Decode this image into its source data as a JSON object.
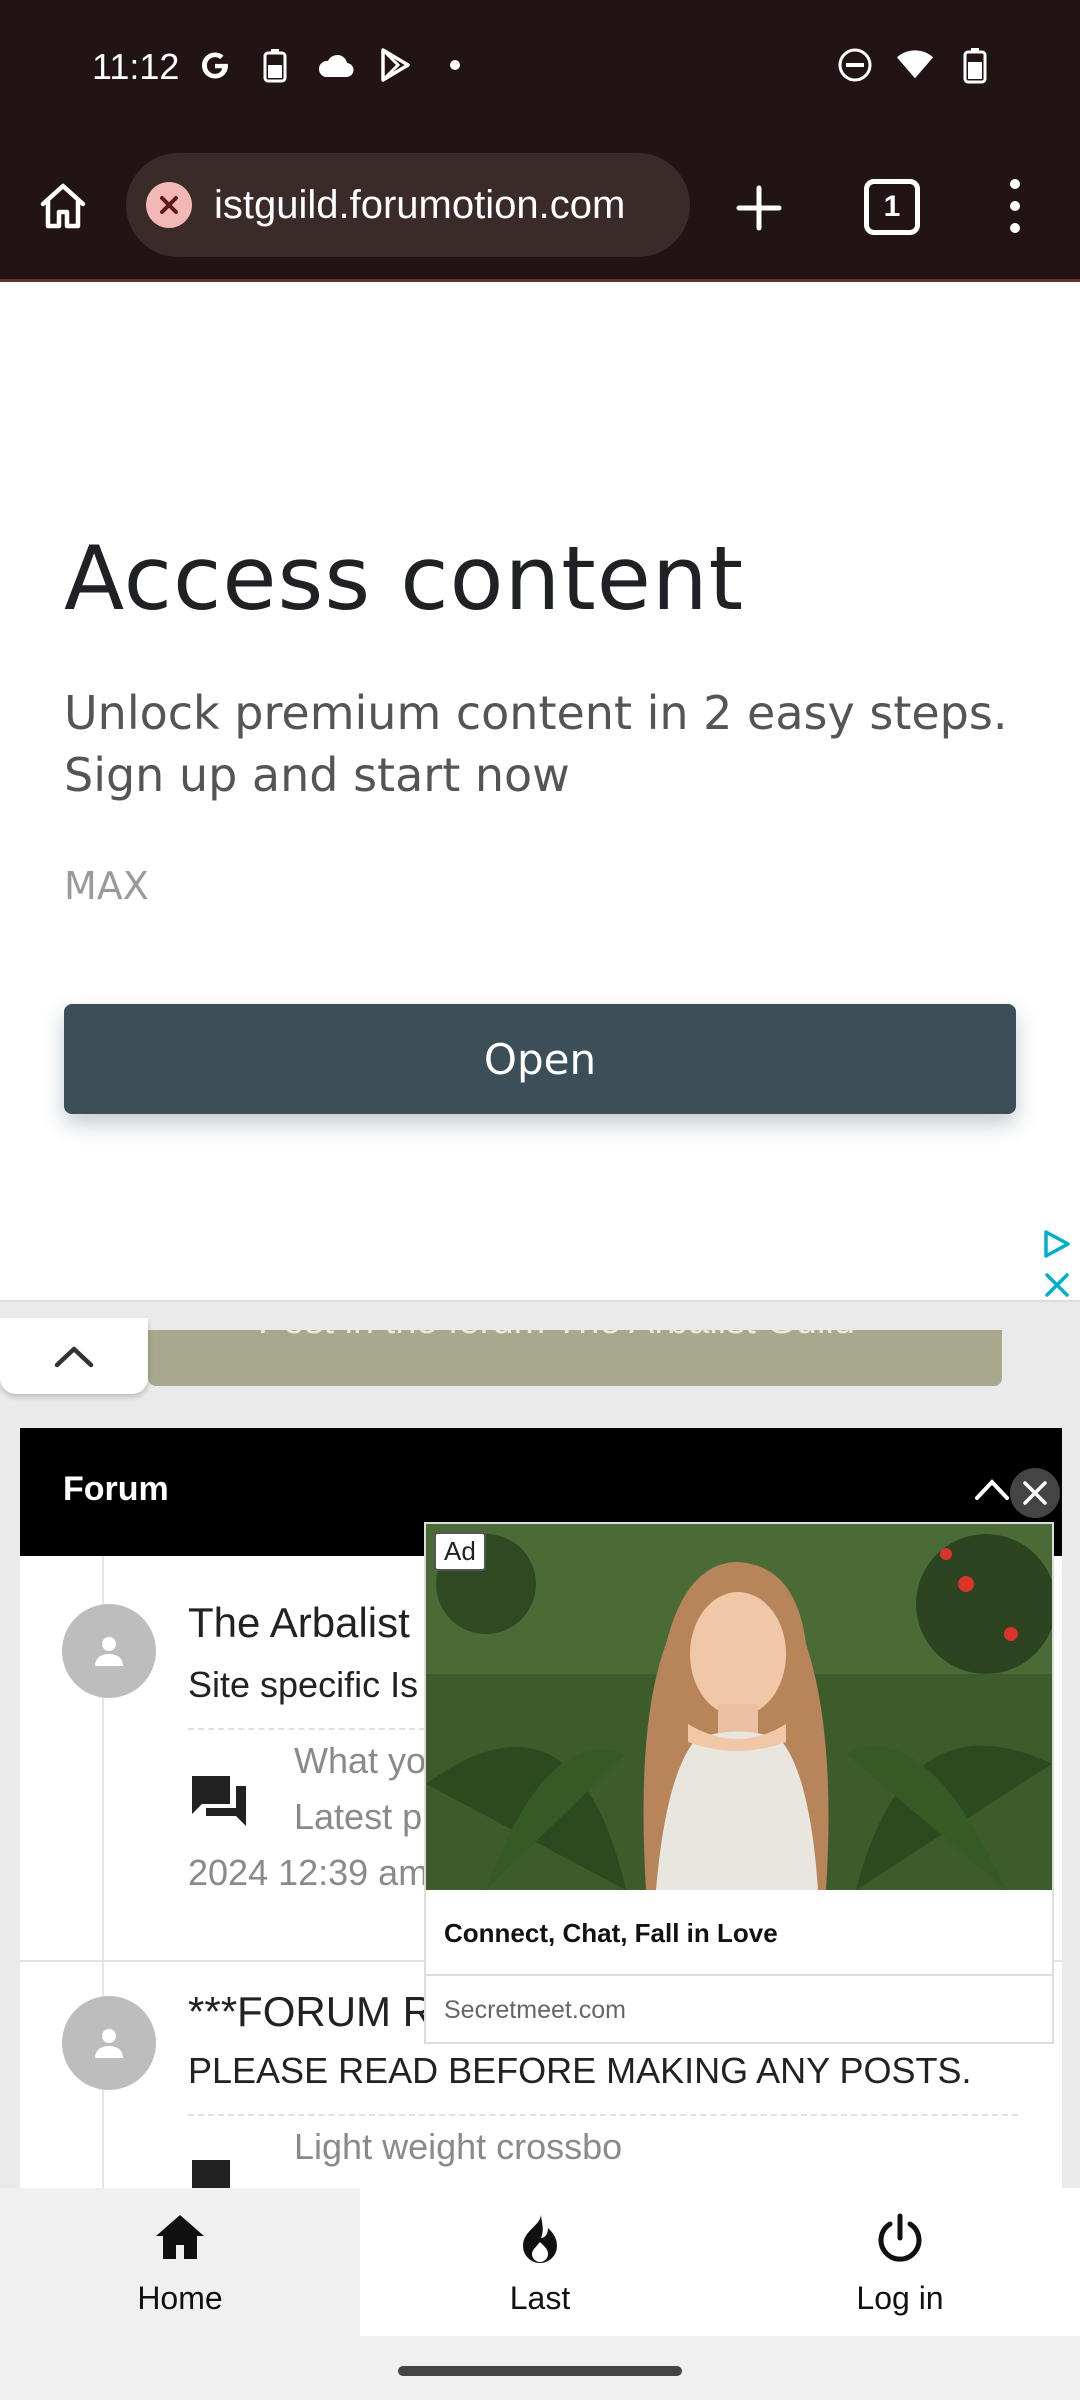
{
  "status_bar": {
    "time": "11:12",
    "left_icons": [
      "google-icon",
      "battery-saver-icon",
      "cloud-icon",
      "play-store-icon",
      "dot-icon"
    ],
    "right_icons": [
      "do-not-disturb-icon",
      "wifi-icon",
      "battery-icon"
    ]
  },
  "browser": {
    "url": "istguild.forumotion.com",
    "tab_count": "1"
  },
  "top_ad": {
    "title": "Access content",
    "description": "Unlock premium content in 2 easy steps. Sign up and start now",
    "brand": "MAX",
    "button_label": "Open"
  },
  "banner": {
    "text": "Post in the forum The Arbalist Guild"
  },
  "forum": {
    "header_title": "Forum",
    "rows": [
      {
        "title": "The Arbalist",
        "description": "Site specific Is",
        "last_post_line1": "What yo",
        "last_post_line2": "Latest p",
        "last_post_date": "2024 12:39 am"
      },
      {
        "title": "***FORUM RULES & FAQ",
        "description": "PLEASE READ BEFORE MAKING ANY POSTS.",
        "last_post_line1": "Light weight crossbo"
      }
    ]
  },
  "float_ad": {
    "badge": "Ad",
    "headline": "Connect, Chat, Fall in Love",
    "domain": "Secretmeet.com"
  },
  "bottom_nav": {
    "items": [
      {
        "label": "Home",
        "icon": "home-icon",
        "active": true
      },
      {
        "label": "Last",
        "icon": "flame-icon",
        "active": false
      },
      {
        "label": "Log in",
        "icon": "power-icon",
        "active": false
      }
    ]
  },
  "colors": {
    "browser_chrome": "#221414",
    "ad_button": "#3c4f59",
    "forum_header": "#000000",
    "banner": "#a8a98c"
  }
}
